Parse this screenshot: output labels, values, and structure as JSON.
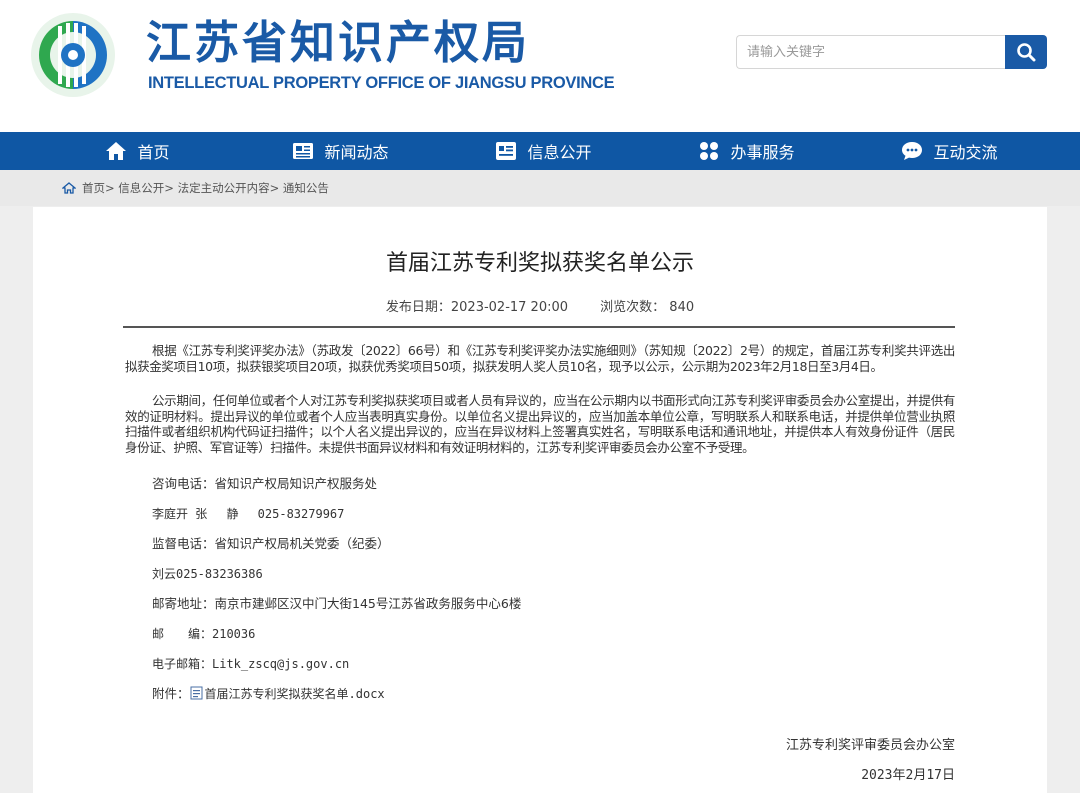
{
  "header": {
    "site_name_cn": "江苏省知识产权局",
    "site_name_en": "INTELLECTUAL PROPERTY OFFICE OF JIANGSU PROVINCE",
    "logo_icon": "jiangsu-ipo-logo",
    "search": {
      "placeholder": "请输入关键字",
      "icon": "search-icon"
    }
  },
  "nav": {
    "items": [
      {
        "label": "首页",
        "icon": "home-icon"
      },
      {
        "label": "新闻动态",
        "icon": "newspaper-icon"
      },
      {
        "label": "信息公开",
        "icon": "info-card-icon"
      },
      {
        "label": "办事服务",
        "icon": "grid-icon"
      },
      {
        "label": "互动交流",
        "icon": "chat-icon"
      }
    ]
  },
  "breadcrumb": "首页> 信息公开> 法定主动公开内容> 通知公告",
  "article": {
    "title": "首届江苏专利奖拟获奖名单公示",
    "publish_date": "发布日期：2023-02-17 20:00",
    "views": "浏览次数： 840",
    "paragraphs": [
      "根据《江苏专利奖评奖办法》（苏政发〔2022〕66号）和《江苏专利奖评奖办法实施细则》（苏知规〔2022〕2号）的规定，首届江苏专利奖共评选出拟获金奖项目10项，拟获银奖项目20项，拟获优秀奖项目50项，拟获发明人奖人员10名，现予以公示，公示期为2023年2月18日至3月4日。",
      "公示期间，任何单位或者个人对江苏专利奖拟获奖项目或者人员有异议的，应当在公示期内以书面形式向江苏专利奖评审委员会办公室提出，并提供有效的证明材料。提出异议的单位或者个人应当表明真实身份。以单位名义提出异议的，应当加盖本单位公章，写明联系人和联系电话，并提供单位营业执照扫描件或者组织机构代码证扫描件；以个人名义提出异议的，应当在异议材料上签署真实姓名，写明联系电话和通讯地址，并提供本人有效身份证件（居民身份证、护照、军官证等）扫描件。未提供书面异议材料和有效证明材料的，江苏专利奖评审委员会办公室不予受理。"
    ],
    "contact_consult": "咨询电话：省知识产权局知识产权服务处",
    "contact_consult_names": "李庭开 张　 静　 025-83279967",
    "contact_supervise": "监督电话：省知识产权局机关党委（纪委）",
    "contact_supervise_names": "刘云025-83236386",
    "mail_address": "邮寄地址：南京市建邺区汉中门大街145号江苏省政务服务中心6楼",
    "postcode": "邮　　编：210036",
    "email": "电子邮箱：Litk_zscq@js.gov.cn",
    "attachment_label": "附件：",
    "attachment_file": "首届江苏专利奖拟获奖名单.docx",
    "attachment_icon": "document-icon",
    "signature_org": "江苏专利奖评审委员会办公室",
    "signature_date": "2023年2月17日"
  },
  "colors": {
    "brand_blue": "#1a5aa6",
    "nav_blue": "#0f57a4",
    "logo_green": "#2fa84f",
    "logo_blue": "#1f73c4"
  }
}
